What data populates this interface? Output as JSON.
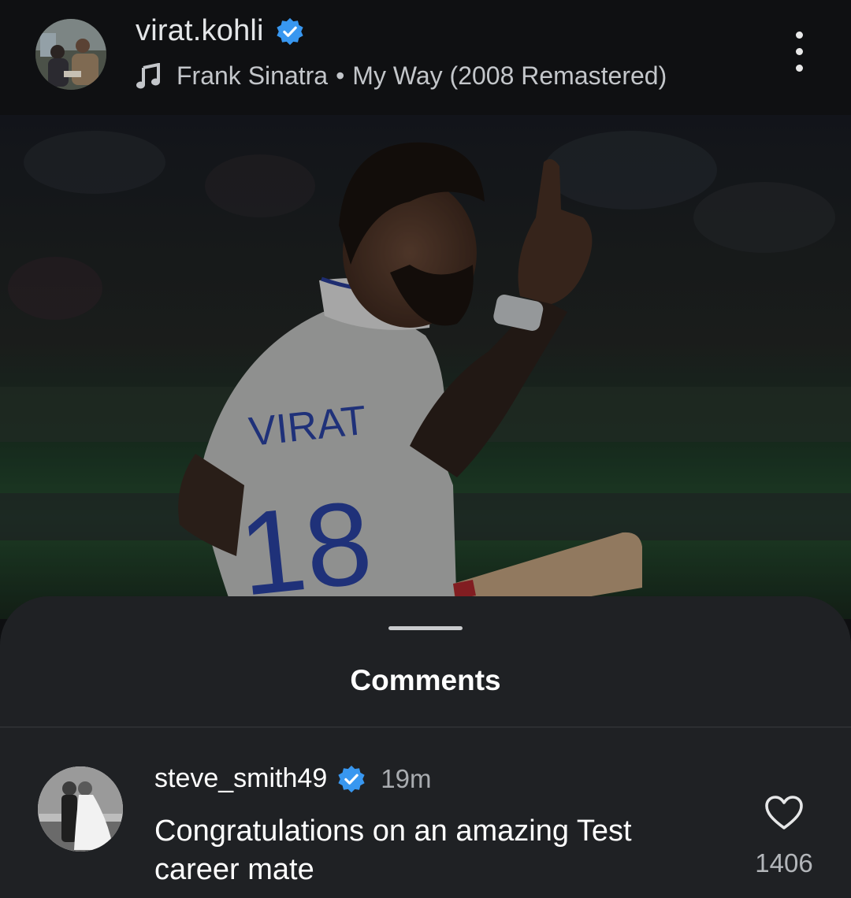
{
  "header": {
    "username": "virat.kohli",
    "verified_icon": "verified-badge-icon",
    "music_icon": "music-note-icon",
    "artist": "Frank Sinatra",
    "separator": "•",
    "song": "My Way (2008 Remastered)",
    "more_icon": "more-vertical-icon"
  },
  "photo": {
    "jersey_name": "VIRAT",
    "jersey_number": "18"
  },
  "comments_sheet": {
    "title": "Comments",
    "comments": [
      {
        "username": "steve_smith49",
        "verified": true,
        "time": "19m",
        "text": "Congratulations on an amazing Test career mate",
        "like_icon": "heart-outline-icon",
        "likes": "1406"
      }
    ]
  },
  "colors": {
    "verified_blue": "#3897f0",
    "sheet_bg": "#1f2124",
    "header_bg": "#0f1012"
  }
}
